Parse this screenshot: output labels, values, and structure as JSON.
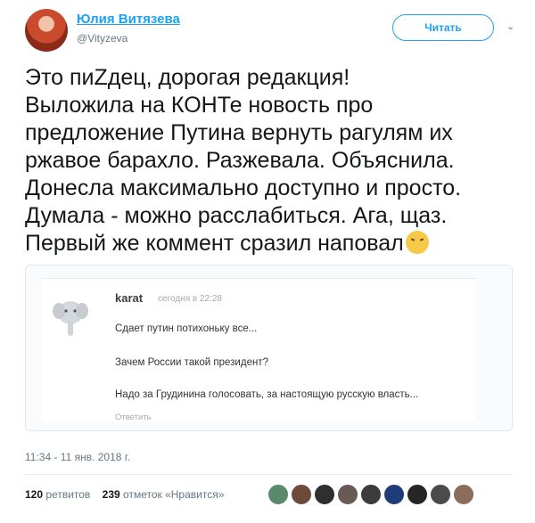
{
  "author": {
    "name": "Юлия Витязева",
    "handle": "@Vityzeva"
  },
  "follow_button": "Читать",
  "tweet": {
    "lines": [
      "Это пиZдец, дорогая редакция!",
      "Выложила на КОНТе новость про",
      "предложение Путина вернуть рагулям их",
      "ржавое барахло. Разжевала. Объяснила.",
      "Донесла максимально доступно и просто.",
      "Думала - можно расслабиться. Ага, щаз.",
      "Первый же коммент сразил наповал"
    ]
  },
  "embedded_comment": {
    "user": "karat",
    "time": "сегодня в 22:28",
    "lines": [
      "Сдает путин потихоньку все...",
      "Зачем России такой президент?",
      "Надо за Грудинина голосовать, за настоящую русскую власть..."
    ],
    "reply_label": "Ответить"
  },
  "timestamp": "11:34 - 11 янв. 2018 г.",
  "stats": {
    "retweets_count": "120",
    "retweets_label": "ретвитов",
    "likes_count": "239",
    "likes_label": "отметок «Нравится»"
  },
  "liker_avatar_colors": [
    "#5a8a6a",
    "#6d4b3a",
    "#2f2f2f",
    "#6a5a55",
    "#3c3c3c",
    "#1f3c7a",
    "#262626",
    "#4b4b4b",
    "#8a6d5a"
  ]
}
